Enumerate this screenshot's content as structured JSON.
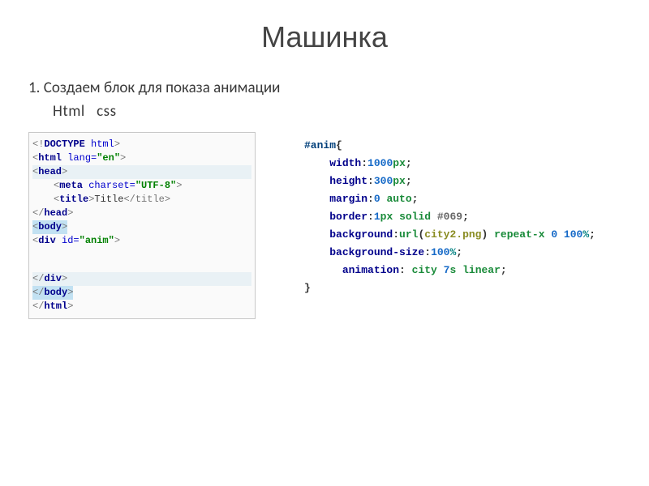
{
  "title": "Машинка",
  "bullet": "1. Создаем блок для показа анимации",
  "sublabels": {
    "html": "Html",
    "css": "css"
  },
  "html_code": {
    "l1": {
      "sym": "<!",
      "doctype": "DOCTYPE ",
      "html": "html",
      "end": ">"
    },
    "l2": {
      "o": "<",
      "tag": "html ",
      "attr": "lang=",
      "val": "\"en\"",
      "c": ">"
    },
    "l3": {
      "o": "<",
      "tag": "head",
      "c": ">"
    },
    "l4": {
      "o": "<",
      "tag": "meta ",
      "attr": "charset=",
      "val": "\"UTF-8\"",
      "c": ">"
    },
    "l5": {
      "o": "<",
      "tag": "title",
      "c": ">",
      "text": "Title",
      "ct": "</title>"
    },
    "l6": {
      "o": "</",
      "tag": "head",
      "c": ">"
    },
    "l7": {
      "o": "<",
      "tag": "body",
      "c": ">"
    },
    "l8": {
      "o": "<",
      "tag": "div ",
      "attr": "id=",
      "val": "\"anim\"",
      "c": ">"
    },
    "l9": {
      "o": "</",
      "tag": "div",
      "c": ">"
    },
    "l10": {
      "o": "</",
      "tag": "body",
      "c": ">"
    },
    "l11": {
      "o": "</",
      "tag": "html",
      "c": ">"
    }
  },
  "css_code": {
    "sel": "#anim",
    "obr": "{",
    "lines": [
      {
        "prop": "width",
        "colon": ":",
        "num": "1000",
        "unit": "px",
        "semi": ";"
      },
      {
        "prop": "height",
        "colon": ":",
        "num": "300",
        "unit": "px",
        "semi": ";"
      },
      {
        "prop": "margin",
        "colon": ":",
        "num": "0",
        "kw": " auto",
        "semi": ";"
      },
      {
        "prop": "border",
        "colon": ":",
        "num": "1",
        "unit": "px",
        "kw": " solid ",
        "hex": "#069",
        "semi": ";"
      },
      {
        "prop": "background",
        "colon": ":",
        "urlkw": "url",
        "po": "(",
        "urlval": "city2.png",
        "pc": ")",
        "kw": " repeat-x ",
        "num2": "0 100",
        "pct": "%",
        "semi": ";"
      },
      {
        "prop": "background-size",
        "colon": ":",
        "num": "100",
        "pct": "%",
        "semi": ";"
      },
      {
        "pad": "  ",
        "prop": "animation",
        "colon": ": ",
        "kw": "city ",
        "num": "7",
        "unit": "s",
        "kw2": " linear",
        "semi": ";"
      }
    ],
    "cbr": "}"
  }
}
